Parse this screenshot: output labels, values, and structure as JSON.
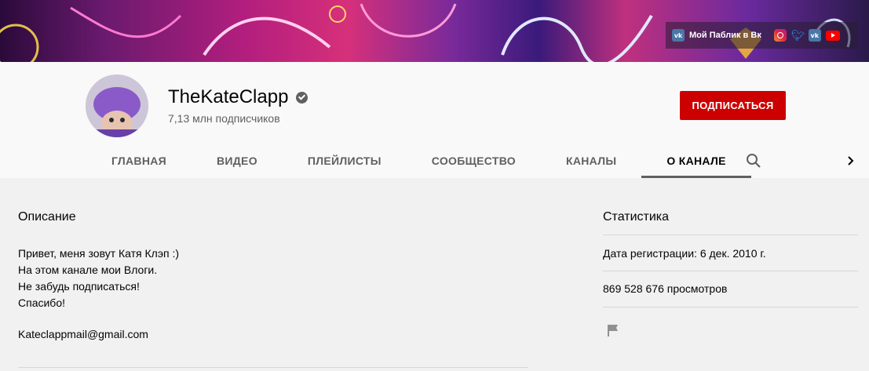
{
  "banner": {
    "link_label": "Мой Паблик в Вк",
    "vk_icon_text": "vk",
    "icons": [
      "vk-icon",
      "instagram-icon",
      "twitter-icon",
      "vk-icon",
      "youtube-icon"
    ]
  },
  "channel": {
    "name": "TheKateClapp",
    "subscribers": "7,13 млн подписчиков",
    "subscribe_label": "ПОДПИСАТЬСЯ"
  },
  "tabs": [
    {
      "label": "ГЛАВНАЯ"
    },
    {
      "label": "ВИДЕО"
    },
    {
      "label": "ПЛЕЙЛИСТЫ"
    },
    {
      "label": "СООБЩЕСТВО"
    },
    {
      "label": "КАНАЛЫ"
    },
    {
      "label": "О КАНАЛЕ"
    }
  ],
  "description": {
    "title": "Описание",
    "lines": [
      "Привет, меня зовут Катя Клэп :)",
      "На этом канале мои Влоги.",
      "Не забудь подписаться!",
      "Спасибо!"
    ],
    "email": "Kateclappmail@gmail.com"
  },
  "stats": {
    "title": "Статистика",
    "registration": "Дата регистрации: 6 дек. 2010 г.",
    "views": "869 528 676 просмотров"
  },
  "colors": {
    "subscribe": "#cc0000",
    "text": "#030303",
    "secondary_text": "#606060",
    "background": "#f1f1f1"
  }
}
